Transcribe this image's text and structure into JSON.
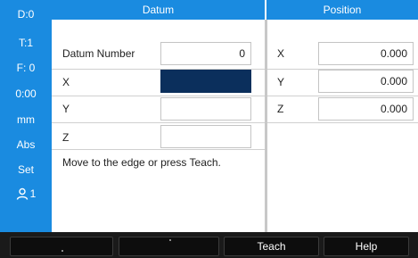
{
  "sidebar": {
    "items": [
      {
        "label": "D:0"
      },
      {
        "label": "T:1"
      },
      {
        "label": "F:  0"
      },
      {
        "label": "0:00"
      },
      {
        "label": "mm"
      },
      {
        "label": "Abs"
      },
      {
        "label": "Set"
      },
      {
        "label": "1",
        "icon": "user-icon"
      }
    ]
  },
  "datum": {
    "header": "Datum",
    "rows": [
      {
        "label": "Datum Number",
        "value": "0"
      },
      {
        "label": "X",
        "value": ""
      },
      {
        "label": "Y",
        "value": ""
      },
      {
        "label": "Z",
        "value": ""
      }
    ],
    "message": "Move to the edge or press Teach."
  },
  "position": {
    "header": "Position",
    "rows": [
      {
        "label": "X",
        "value": "0.000"
      },
      {
        "label": "Y",
        "value": "0.000"
      },
      {
        "label": "Z",
        "value": "0.000"
      }
    ]
  },
  "softkeys": [
    {
      "label": ""
    },
    {
      "label": ""
    },
    {
      "label": "Teach"
    },
    {
      "label": "Help"
    }
  ],
  "colors": {
    "accent": "#1a8be0",
    "selected_field": "#0b2f5c",
    "softkey_bar": "#1a1a1a"
  }
}
